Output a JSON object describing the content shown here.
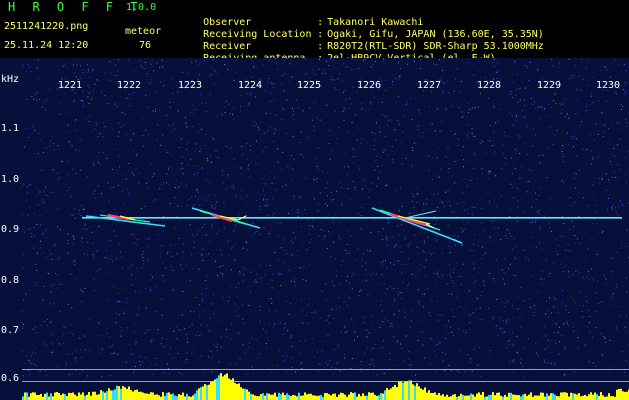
{
  "header": {
    "app_title": "H R O F F T",
    "app_version": "1.0.0",
    "file_name": "2511241220.png",
    "datetime": "25.11.24 12:20",
    "mode_label": "meteor",
    "mode_count": "76",
    "info": [
      {
        "key": "Observer",
        "value": "Takanori Kawachi"
      },
      {
        "key": "Receiving Location",
        "value": "Ogaki, Gifu, JAPAN (136.60E, 35.35N)"
      },
      {
        "key": "Receiver",
        "value": "R820T2(RTL-SDR) SDR-Sharp 53.1000MHz"
      },
      {
        "key": "Receiving antenna",
        "value": "2el-HB9CV Vertical (el. E-W)"
      }
    ]
  },
  "axes": {
    "y_unit": "kHz",
    "x_ticks": [
      "1221",
      "1222",
      "1223",
      "1224",
      "1225",
      "1226",
      "1227",
      "1228",
      "1229",
      "1230"
    ],
    "y_ticks": [
      "1.1",
      "1.0",
      "0.9",
      "0.8",
      "0.7",
      "0.6"
    ]
  },
  "colors": {
    "background": "#06103a",
    "noise": "#2e55d8",
    "carrier": "#66e8ff",
    "meteor_core": "#ff3c8c",
    "level_bar": "#ffff00",
    "title_green": "#3cff3c",
    "header_text": "#ffff66"
  }
}
